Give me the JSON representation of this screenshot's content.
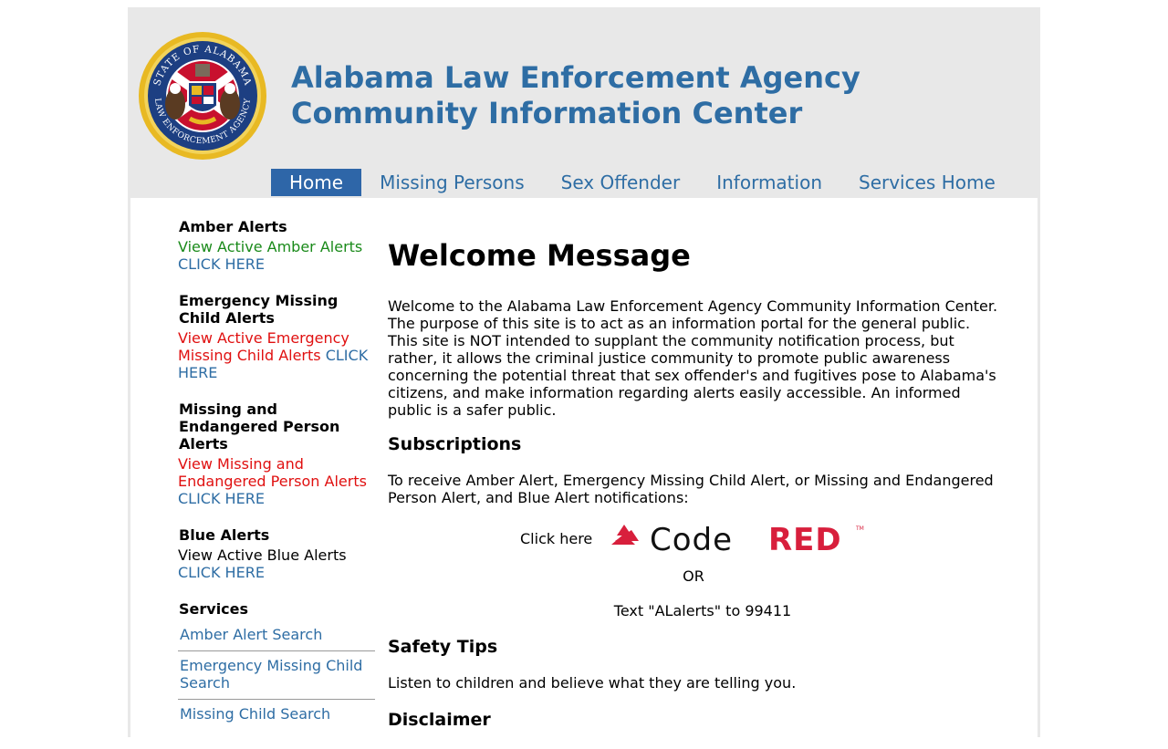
{
  "header": {
    "title_line1": "Alabama Law Enforcement Agency",
    "title_line2": "Community Information Center",
    "seal_text_top": "STATE OF ALABAMA",
    "seal_text_bottom": "LAW ENFORCEMENT AGENCY"
  },
  "nav": {
    "items": [
      {
        "label": "Home",
        "active": true
      },
      {
        "label": "Missing Persons"
      },
      {
        "label": "Sex Offender"
      },
      {
        "label": "Information"
      },
      {
        "label": "Services Home"
      }
    ]
  },
  "sidebar": {
    "amber": {
      "heading": "Amber Alerts",
      "view": "View Active Amber Alerts",
      "click": "CLICK HERE"
    },
    "emc": {
      "heading": "Emergency Missing Child Alerts",
      "view": "View Active Emergency Missing Child Alerts",
      "click": "CLICK HERE"
    },
    "mep": {
      "heading": "Missing and Endangered Person Alerts",
      "view": "View Missing and Endangered Person Alerts",
      "click": "CLICK HERE"
    },
    "blue": {
      "heading": "Blue Alerts",
      "view": "View Active Blue Alerts",
      "click": "CLICK HERE"
    },
    "services": {
      "heading": "Services",
      "items": [
        "Amber Alert Search",
        "Emergency Missing Child Search",
        "Missing Child Search"
      ]
    }
  },
  "main": {
    "title": "Welcome Message",
    "welcome": "Welcome to the Alabama Law Enforcement Agency Community Information Center. The purpose of this site is to act as an information portal for the general public. This site is NOT intended to supplant the community notification process, but rather, it allows the criminal justice community to promote public awareness concerning the potential threat that sex offender's and fugitives pose to Alabama's citizens, and make information regarding alerts easily accessible. An informed public is a safer public.",
    "subscriptions_heading": "Subscriptions",
    "subscriptions_text": "To receive Amber Alert, Emergency Missing Child Alert, or Missing and Endangered Person Alert, and Blue Alert notifications:",
    "click_here": "Click here",
    "codered_logo": "CodeRED",
    "codered_red_part": "RED",
    "codered_black_part": "Code",
    "tm": "TM",
    "or": "OR",
    "text_line": "Text \"ALalerts\" to 99411",
    "safety_heading": "Safety Tips",
    "safety_text": "Listen to children and believe what they are telling you.",
    "disclaimer_heading": "Disclaimer"
  },
  "colors": {
    "brand_blue": "#2e6da4",
    "nav_active": "#2e66a8",
    "header_bg": "#e8e8e8",
    "alert_red": "#e01010",
    "amber_green": "#1a8a1a",
    "codered_red": "#d81f3c"
  }
}
